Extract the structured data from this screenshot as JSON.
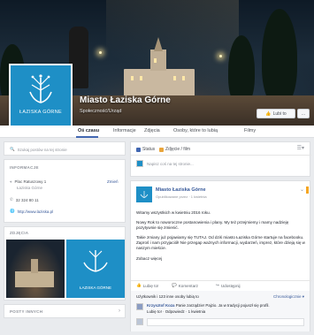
{
  "cover": {
    "title": "Miasto Łaziska Górne",
    "subtitle": "Społeczność/Urząd",
    "like_button": "Lubi to",
    "more_button": "...",
    "logo_text": "ŁAZISKA GÓRNE"
  },
  "nav": {
    "tabs": [
      "Oś czasu",
      "Informacje",
      "Zdjęcia",
      "Osoby, które to lubią",
      "Filmy"
    ],
    "active_tab": "Oś czasu"
  },
  "left": {
    "search_placeholder": "Szukaj postów na tej stronie",
    "info_header": "INFORMACJE",
    "address": "Plac Ratuszowy 1",
    "address_city": "Łaziska Górne",
    "edit_link": "Zmień",
    "phone": "32 324 80 11",
    "website": "http://www.laziska.pl",
    "photos_header": "ZDJĘCIA",
    "logo_text_small": "ŁAZISKA GÓRNE",
    "posts_header": "POSTY INNYCH"
  },
  "composer": {
    "status_label": "Status",
    "photo_label": "Zdjęcie / film",
    "placeholder": "Napisz coś na tej stronie..."
  },
  "post": {
    "author": "Miasto Łaziska Górne",
    "meta": "Opublikowane przez · 1 kwietnia",
    "line1": "Witamy wszystkich w kwietniu 2016 roku.",
    "line2": "Nowy Rok to noworoczne postanowienia i plany. My też przejmiemy i mamy nadzieję pozytywnie się zmienić.",
    "line3": "Takie zmiany już pojawiamy się TUTAJ. Od dziś miasto Łaziska Górne startuje na facebooku. Zaproś i nam przyjaciół! Nie przegap ważnych informacji, wydarzeń, imprez, które dzieją się w naszym mieście.",
    "see_more": "Zobacz więcej",
    "action_like": "Lubię to!",
    "action_comment": "Komentarz",
    "action_share": "Udostępnij",
    "likes_text": "Użytkownik i 123 inne osoby lubią to",
    "chronology": "Chronologicznie",
    "comment_author": "Krzysztof Koza",
    "comment_text": "Panie zarządzie! Pajzio. Ja w tradycji pojuszł się profil.",
    "comment_meta": "Lubię to! · Odpowiedz · 1 kwietnia"
  },
  "colors": {
    "accent": "#4267b2",
    "link": "#365899",
    "brand_blue": "#1e8fc6"
  }
}
